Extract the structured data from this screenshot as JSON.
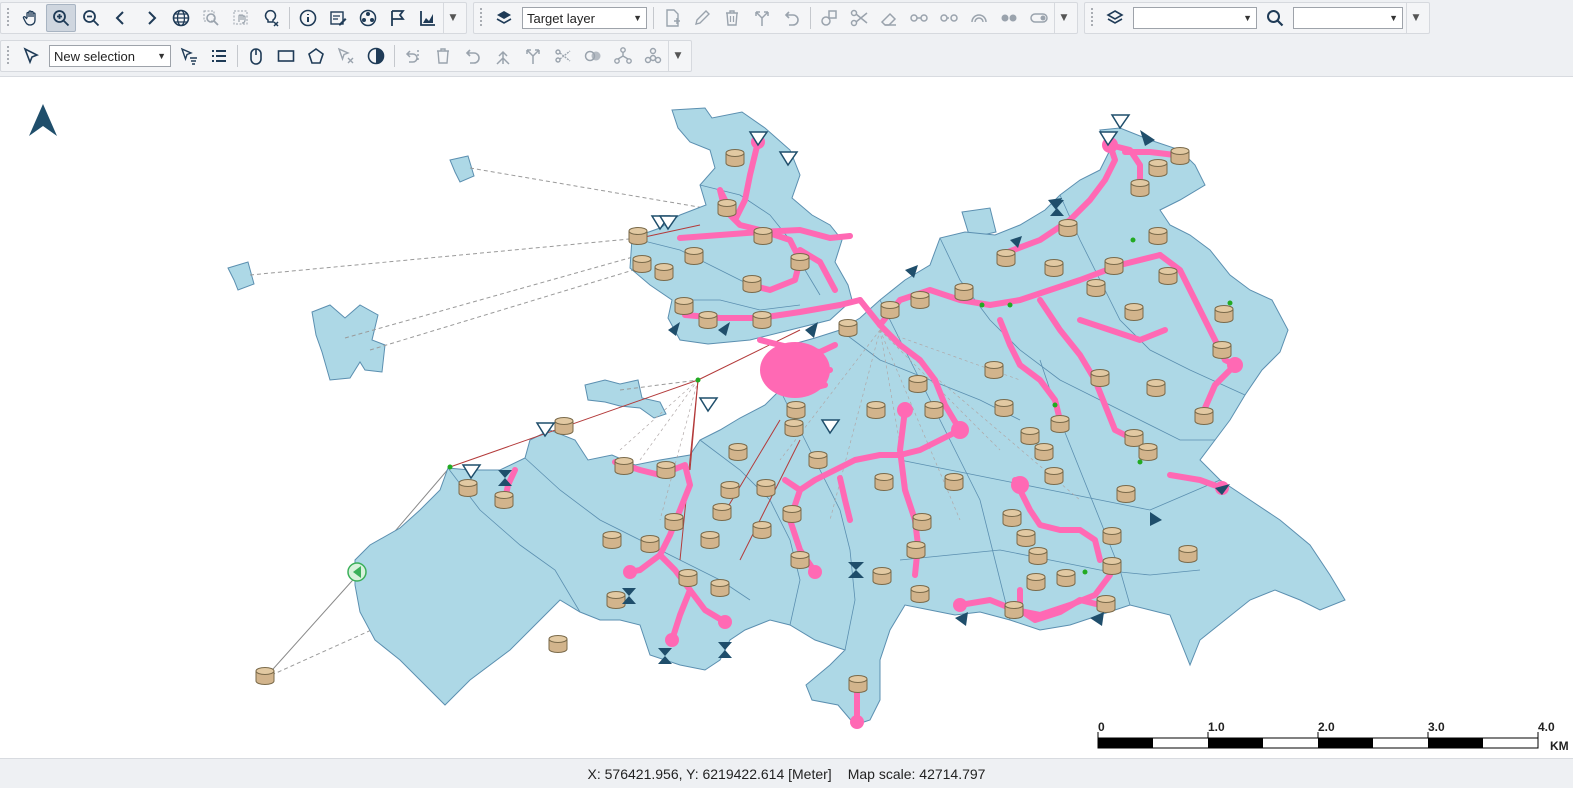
{
  "toolbar": {
    "target_layer_label": "Target layer",
    "selection_mode_label": "New selection",
    "layer_combo_value": "",
    "search_combo_value": ""
  },
  "map": {
    "north_arrow": "north-arrow-icon",
    "colors": {
      "polygon_fill": "#add8e6",
      "polygon_stroke": "#5b8fb0",
      "pipeline": "#ff69b4",
      "tank_fill": "#d2b48c",
      "node": "#1f5b7a",
      "connector_red": "#b33a3a",
      "connector_grey": "#9a9a9a",
      "green_dot": "#22aa22"
    },
    "scale_labels": [
      "0",
      "1.0",
      "2.0",
      "3.0",
      "4.0"
    ],
    "scale_unit": "KM"
  },
  "status": {
    "coordinates": "X: 576421.956, Y: 6219422.614 [Meter]",
    "scale": "Map scale: 42714.797"
  }
}
